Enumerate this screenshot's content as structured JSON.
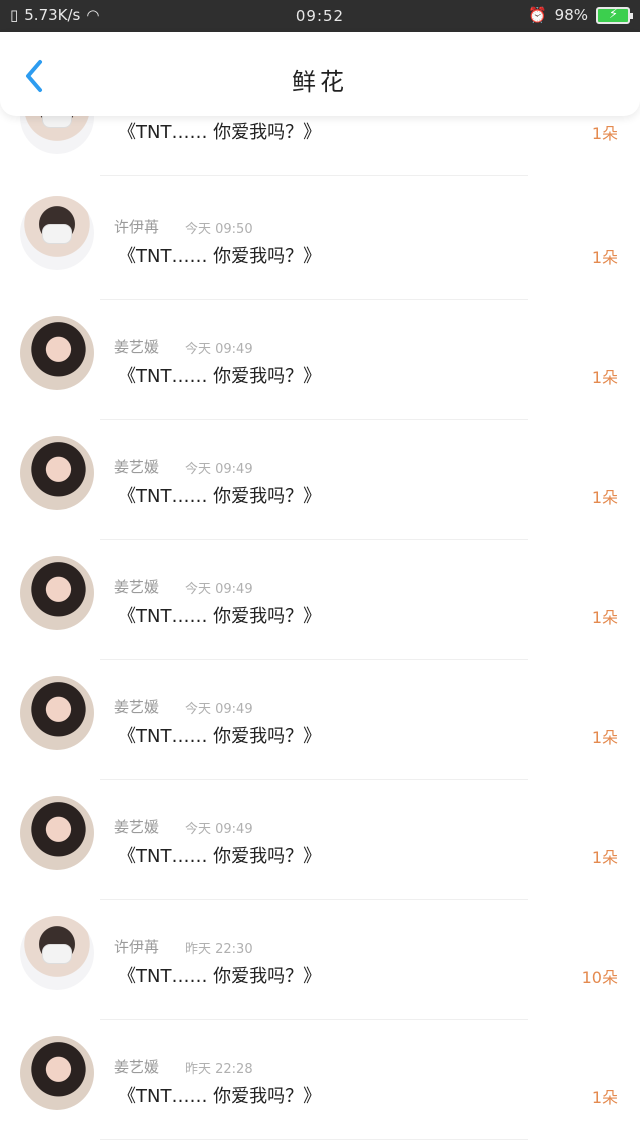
{
  "status_bar": {
    "network_speed": "5.73K/s",
    "time": "09:52",
    "battery": "98%"
  },
  "header": {
    "title": "鲜花"
  },
  "items": [
    {
      "name": "",
      "time": "",
      "message": "《TNT…… 你爱我吗？》",
      "count": "1朵",
      "avatar": "boy"
    },
    {
      "name": "许伊苒",
      "time": "今天 09:50",
      "message": "《TNT…… 你爱我吗？》",
      "count": "1朵",
      "avatar": "boy"
    },
    {
      "name": "姜艺媛",
      "time": "今天 09:49",
      "message": "《TNT…… 你爱我吗？》",
      "count": "1朵",
      "avatar": "girl"
    },
    {
      "name": "姜艺媛",
      "time": "今天 09:49",
      "message": "《TNT…… 你爱我吗？》",
      "count": "1朵",
      "avatar": "girl"
    },
    {
      "name": "姜艺媛",
      "time": "今天 09:49",
      "message": "《TNT…… 你爱我吗？》",
      "count": "1朵",
      "avatar": "girl"
    },
    {
      "name": "姜艺媛",
      "time": "今天 09:49",
      "message": "《TNT…… 你爱我吗？》",
      "count": "1朵",
      "avatar": "girl"
    },
    {
      "name": "姜艺媛",
      "time": "今天 09:49",
      "message": "《TNT…… 你爱我吗？》",
      "count": "1朵",
      "avatar": "girl"
    },
    {
      "name": "许伊苒",
      "time": "昨天 22:30",
      "message": "《TNT…… 你爱我吗？》",
      "count": "10朵",
      "avatar": "boy"
    },
    {
      "name": "姜艺媛",
      "time": "昨天 22:28",
      "message": "《TNT…… 你爱我吗？》",
      "count": "1朵",
      "avatar": "girl"
    }
  ]
}
